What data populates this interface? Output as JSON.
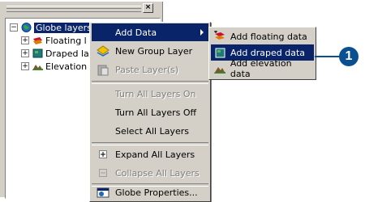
{
  "toc": {
    "close_glyph": "×",
    "nodes": [
      {
        "label": "Globe layers",
        "icon": "globe-icon",
        "expander": "⊟"
      },
      {
        "label": "Floating l",
        "icon": "floating-layer-icon",
        "expander": "⊞"
      },
      {
        "label": "Draped la",
        "icon": "draped-layer-icon",
        "expander": "⊞"
      },
      {
        "label": "Elevation",
        "icon": "elevation-layer-icon",
        "expander": "⊞"
      }
    ]
  },
  "context_menu": {
    "items": [
      {
        "label": "Add Data",
        "state": "highlighted",
        "has_submenu": true
      },
      {
        "label": "New Group Layer",
        "icon": "new-group-layer-icon"
      },
      {
        "label": "Paste Layer(s)",
        "icon": "paste-icon",
        "state": "disabled"
      },
      {
        "label": "Turn All Layers On",
        "state": "disabled"
      },
      {
        "label": "Turn All Layers Off"
      },
      {
        "label": "Select All Layers"
      },
      {
        "label": "Expand All Layers",
        "icon": "expand-icon"
      },
      {
        "label": "Collapse All Layers",
        "icon": "collapse-icon",
        "state": "disabled"
      },
      {
        "label": "Globe Properties...",
        "icon": "properties-icon"
      }
    ]
  },
  "submenu": {
    "items": [
      {
        "label": "Add floating data",
        "icon": "add-floating-data-icon"
      },
      {
        "label": "Add draped data",
        "icon": "add-draped-data-icon",
        "state": "highlighted"
      },
      {
        "label": "Add elevation data",
        "icon": "add-elevation-data-icon"
      }
    ]
  },
  "callout": {
    "number": "1",
    "color": "#0a4f8f"
  },
  "colors": {
    "highlight": "#0a246a",
    "face": "#d4d0c8"
  }
}
